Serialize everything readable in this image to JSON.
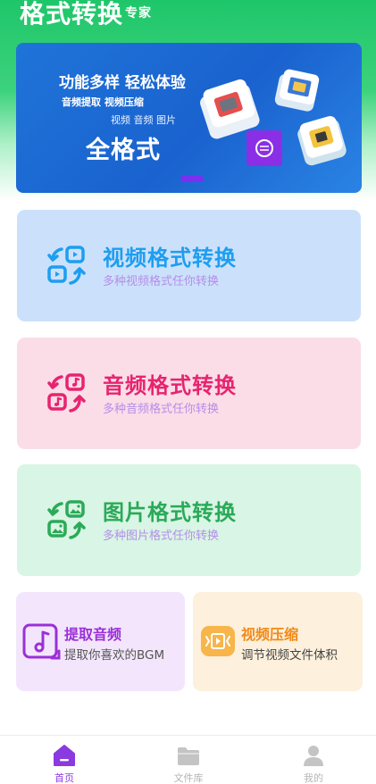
{
  "header": {
    "title": "格式转换",
    "title_sub": "专家"
  },
  "banner": {
    "line1": "功能多样 轻松体验",
    "line2": "音频提取 视频压缩",
    "line3": "视频 音频 图片",
    "line4": "全格式"
  },
  "features": {
    "video": {
      "title": "视频格式转换",
      "subtitle": "多种视频格式任你转换"
    },
    "audio": {
      "title": "音频格式转换",
      "subtitle": "多种音频格式任你转换"
    },
    "image": {
      "title": "图片格式转换",
      "subtitle": "多种图片格式任你转换"
    }
  },
  "tools": {
    "extract": {
      "title": "提取音频",
      "subtitle": "提取你喜欢的BGM"
    },
    "compress": {
      "title": "视频压缩",
      "subtitle": "调节视频文件体积"
    }
  },
  "tabbar": {
    "items": [
      {
        "label": "首页",
        "icon": "home-icon",
        "active": true
      },
      {
        "label": "文件库",
        "icon": "folder-icon",
        "active": false
      },
      {
        "label": "我的",
        "icon": "user-icon",
        "active": false
      }
    ]
  },
  "colors": {
    "header_green": "#1ec66a",
    "banner_blue": "#1a62cf",
    "accent_purple": "#8a3ae0",
    "video_blue": "#1d9ef0",
    "audio_pink": "#e7246f",
    "image_green": "#2aaa58",
    "compress_orange": "#f08a18"
  }
}
